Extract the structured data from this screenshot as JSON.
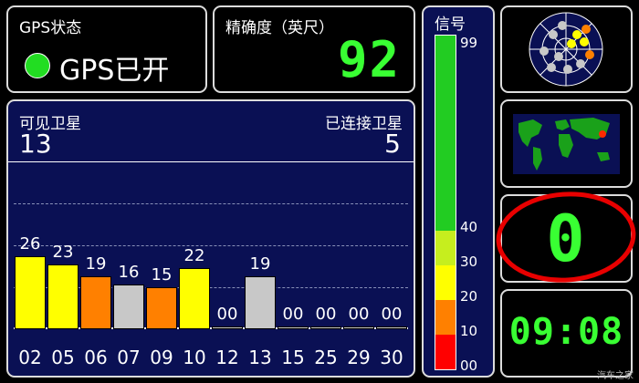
{
  "gps_status": {
    "label": "GPS状态",
    "value": "GPS已开",
    "indicator_color": "#22dd22"
  },
  "accuracy": {
    "label": "精确度（英尺）",
    "value": "92"
  },
  "signal": {
    "label": "信号",
    "ticks": [
      "99",
      "40",
      "30",
      "20",
      "10",
      "00"
    ],
    "bands": [
      {
        "color": "#ff0000"
      },
      {
        "color": "#ff8000"
      },
      {
        "color": "#ffff00"
      },
      {
        "color": "#c6ee1e"
      },
      {
        "color": "#22cc22"
      }
    ]
  },
  "satellites": {
    "visible_label": "可见卫星",
    "visible_count": "13",
    "connected_label": "已连接卫星",
    "connected_count": "5"
  },
  "chart_data": {
    "type": "bar",
    "categories": [
      "02",
      "05",
      "06",
      "07",
      "09",
      "10",
      "12",
      "13",
      "15",
      "25",
      "29",
      "30"
    ],
    "values": [
      26,
      23,
      19,
      16,
      15,
      22,
      0,
      19,
      0,
      0,
      0,
      0
    ],
    "value_labels": [
      "26",
      "23",
      "19",
      "16",
      "15",
      "22",
      "00",
      "19",
      "00",
      "00",
      "00",
      "00"
    ],
    "colors": [
      "#ffff00",
      "#ffff00",
      "#ff8000",
      "#c8c8c8",
      "#ff8000",
      "#ffff00",
      "#c8c8c8",
      "#c8c8c8",
      "#c8c8c8",
      "#c8c8c8",
      "#c8c8c8",
      "#c8c8c8"
    ],
    "ylim": [
      0,
      60
    ],
    "grid": "dashed"
  },
  "speed": {
    "value": "0"
  },
  "clock": {
    "value": "09:08"
  },
  "icons": {
    "radar": "satellite-radar-icon",
    "map": "world-map-icon"
  },
  "watermark": "汽车之家"
}
